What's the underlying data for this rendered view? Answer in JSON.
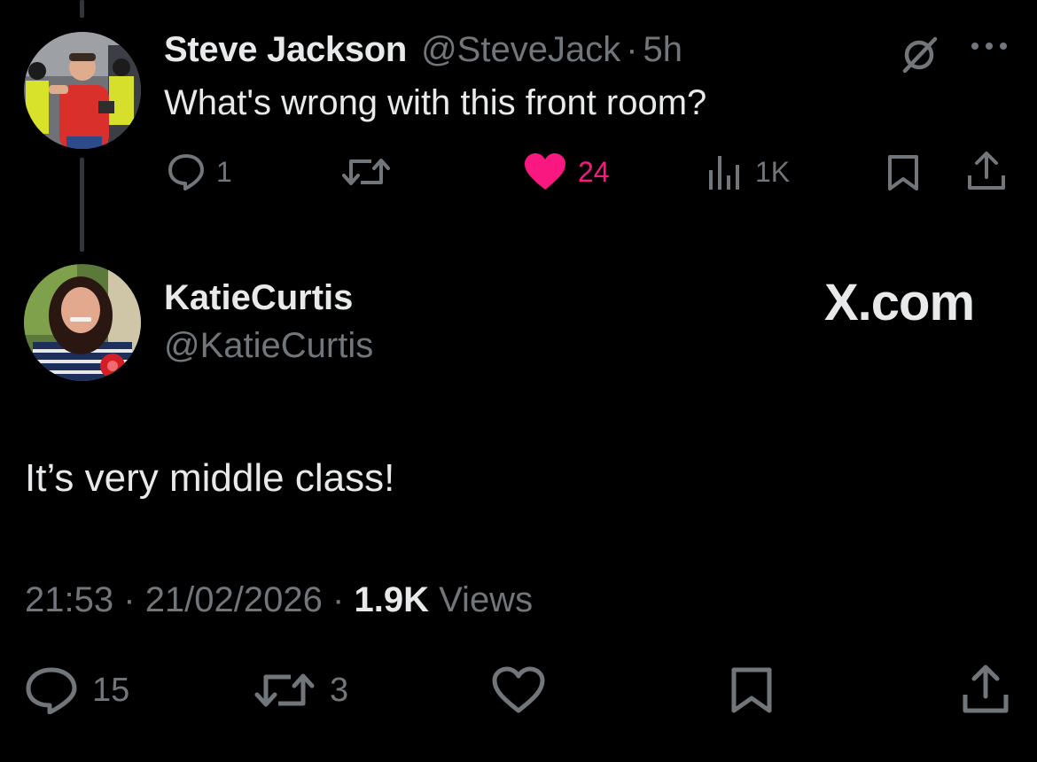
{
  "tweet": {
    "author_name": "Steve Jackson",
    "author_handle": "@SteveJack",
    "separator": "·",
    "time": "5h",
    "text": "What's wrong with this front room?",
    "reply_count": "1",
    "like_count": "24",
    "view_count": "1K",
    "liked": true
  },
  "reply": {
    "author_name": "KatieCurtis",
    "author_handle": "@KatieCurtis",
    "text": "It’s very middle class!",
    "time": "21:53",
    "separator": "·",
    "date": "21/02/2026",
    "views_value": "1.9K",
    "views_label": "Views",
    "reply_count": "15",
    "retweet_count": "3"
  },
  "watermark": "X.com",
  "colors": {
    "background": "#000000",
    "text_primary": "#e7e9ea",
    "text_secondary": "#71767b",
    "like_pink": "#f91880"
  },
  "icons": [
    "reply-icon",
    "retweet-icon",
    "heart-icon",
    "views-icon",
    "bookmark-icon",
    "share-icon",
    "grok-icon",
    "more-icon"
  ]
}
